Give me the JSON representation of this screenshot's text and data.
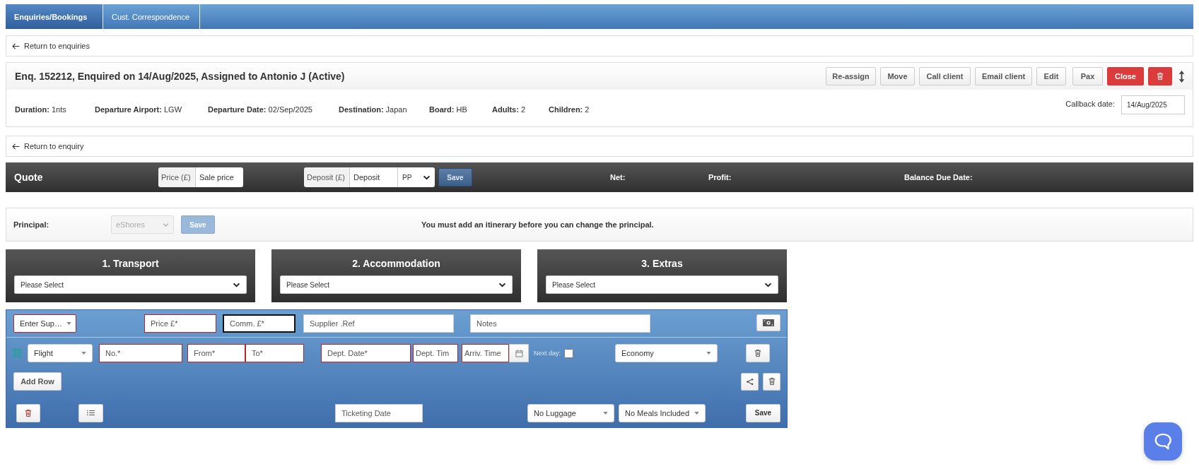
{
  "tabs": [
    {
      "label": "Enquiries/Bookings",
      "selected": true
    },
    {
      "label": "Cust. Correspondence",
      "selected": false
    }
  ],
  "return_to_enquiries": "Return to enquiries",
  "enquiry": {
    "title": "Enq. 152212, Enquired on 14/Aug/2025, Assigned to Antonio J (Active)",
    "actions": [
      {
        "label": "Re-assign",
        "kind": "default"
      },
      {
        "label": "Move",
        "kind": "default"
      },
      {
        "label": "Call client",
        "kind": "default"
      },
      {
        "label": "Email client",
        "kind": "default"
      },
      {
        "label": "Edit",
        "kind": "default"
      },
      {
        "label": "Pax",
        "kind": "default"
      },
      {
        "label": "Close",
        "kind": "danger"
      },
      {
        "kind": "delete"
      }
    ],
    "details": [
      "**Duration:** 1nts",
      "**Departure Airport:** LGW",
      "**Departure Date:** 02/Sep/2025",
      "**Destination:** Japan",
      "**Board:** HB",
      "**Adults:** 2",
      "**Children:** 2"
    ],
    "callback": {
      "label": "Callback date:",
      "value": "14/Aug/2025"
    }
  },
  "return_to_enquiry": "Return to enquiry",
  "quote": {
    "title": "Quote",
    "price": {
      "addon": "Price (£)",
      "placeholder": "Sale price"
    },
    "deposit": {
      "addon": "Deposit (£)",
      "placeholder": "Deposit",
      "unit": "PP"
    },
    "save": "Save",
    "summary": [
      "Net:",
      "Profit:",
      "Balance Due Date:"
    ]
  },
  "principal": {
    "label": "Principal:",
    "value": "eShores",
    "disabled": true,
    "save": "Save",
    "message": "You must add an itinerary before you can change the principal."
  },
  "sections": [
    {
      "title": "1. Transport",
      "value": "Please Select"
    },
    {
      "title": "2. Accommodation",
      "value": "Please Select"
    },
    {
      "title": "3. Extras",
      "value": "Please Select"
    }
  ],
  "itinerary": {
    "supplier": {
      "value": "Enter Sup…",
      "invalid": true
    },
    "top_fields": [
      {
        "placeholder": "Price £*",
        "invalid": true,
        "focused": false
      },
      {
        "placeholder": "Comm. £*",
        "invalid": false,
        "focused": true
      },
      {
        "placeholder": "Supplier .Ref",
        "invalid": false,
        "focused": false
      },
      {
        "placeholder": "Notes",
        "invalid": false,
        "focused": false
      }
    ],
    "segment": {
      "type": "Flight",
      "fields": [
        {
          "placeholder": "No.*",
          "invalid": true
        },
        {
          "placeholder": "From*",
          "invalid": true
        },
        {
          "placeholder": "To*",
          "invalid": true
        },
        {
          "placeholder": "Dept. Date*",
          "invalid": true
        },
        {
          "placeholder": "Dept. Tim",
          "invalid": true
        },
        {
          "placeholder": "Arriv. Time",
          "invalid": true
        }
      ],
      "next_day": {
        "label": "Next day:",
        "checked": false
      },
      "cabin": "Economy"
    },
    "add_row": "Add Row",
    "ticketing_date": {
      "placeholder": "Ticketing Date"
    },
    "luggage": "No Luggage",
    "meals": "No Meals Included",
    "save": "Save"
  }
}
